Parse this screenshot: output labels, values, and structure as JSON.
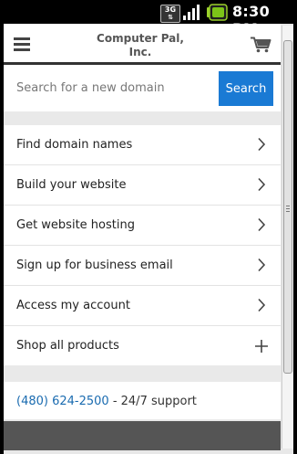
{
  "status_bar": {
    "network": "3G",
    "time": "8:30 PM"
  },
  "header": {
    "brand_line1": "Computer Pal,",
    "brand_line2": "Inc.",
    "menu_icon": "hamburger-icon",
    "cart_icon": "cart-icon"
  },
  "search": {
    "placeholder": "Search for a new domain",
    "value": "",
    "button_label": "Search"
  },
  "menu": {
    "items": [
      {
        "label": "Find domain names",
        "icon": "chevron-right-icon"
      },
      {
        "label": "Build your website",
        "icon": "chevron-right-icon"
      },
      {
        "label": "Get website hosting",
        "icon": "chevron-right-icon"
      },
      {
        "label": "Sign up for business email",
        "icon": "chevron-right-icon"
      },
      {
        "label": "Access my account",
        "icon": "chevron-right-icon"
      },
      {
        "label": "Shop all products",
        "icon": "plus-icon"
      }
    ]
  },
  "support": {
    "phone": "(480) 624-2500",
    "text": " - 24/7 support"
  },
  "colors": {
    "accent": "#1a7ad4",
    "link": "#1a6bb0",
    "header_rule": "#333333"
  }
}
